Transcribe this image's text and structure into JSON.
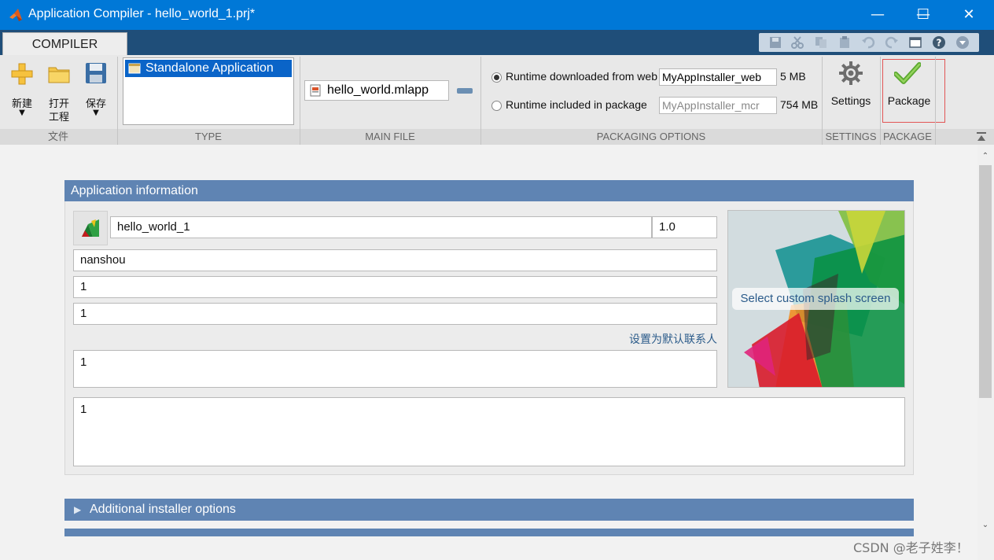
{
  "window": {
    "title": "Application Compiler - hello_world_1.prj*",
    "minimize": "—",
    "maximize": "☐",
    "close": "✕"
  },
  "tab": {
    "label": "COMPILER"
  },
  "ribbon": {
    "file_group": {
      "label": "文件",
      "new_label": "新建",
      "open_label_1": "打开",
      "open_label_2": "工程",
      "save_label": "保存"
    },
    "type_group": {
      "label": "TYPE",
      "selected_item": "Standalone Application"
    },
    "main_file_group": {
      "label": "MAIN FILE",
      "file": "hello_world.mlapp"
    },
    "packaging_group": {
      "label": "PACKAGING OPTIONS",
      "option_web_label": "Runtime downloaded from web",
      "option_web_value": "MyAppInstaller_web",
      "option_web_size": "5 MB",
      "option_pkg_label": "Runtime included in package",
      "option_pkg_placeholder": "MyAppInstaller_mcr",
      "option_pkg_size": "754 MB",
      "selected": "web"
    },
    "settings_group": {
      "label": "SETTINGS",
      "button_label": "Settings"
    },
    "package_group": {
      "label": "PACKAGE",
      "button_label": "Package"
    }
  },
  "app_info": {
    "header": "Application information",
    "app_name": "hello_world_1",
    "version": "1.0",
    "author": "nanshou",
    "email": "1",
    "company": "1",
    "set_default_contact": "设置为默认联系人",
    "summary": "1",
    "description": "1",
    "splash_label": "Select custom splash screen"
  },
  "additional_installer_options": {
    "header": "Additional installer options"
  },
  "watermark": "CSDN @老子姓李！",
  "colors": {
    "titlebar": "#0078d7",
    "tabstrip": "#1f4e79",
    "panel_header": "#5f84b3",
    "type_selected": "#0a64c8"
  }
}
